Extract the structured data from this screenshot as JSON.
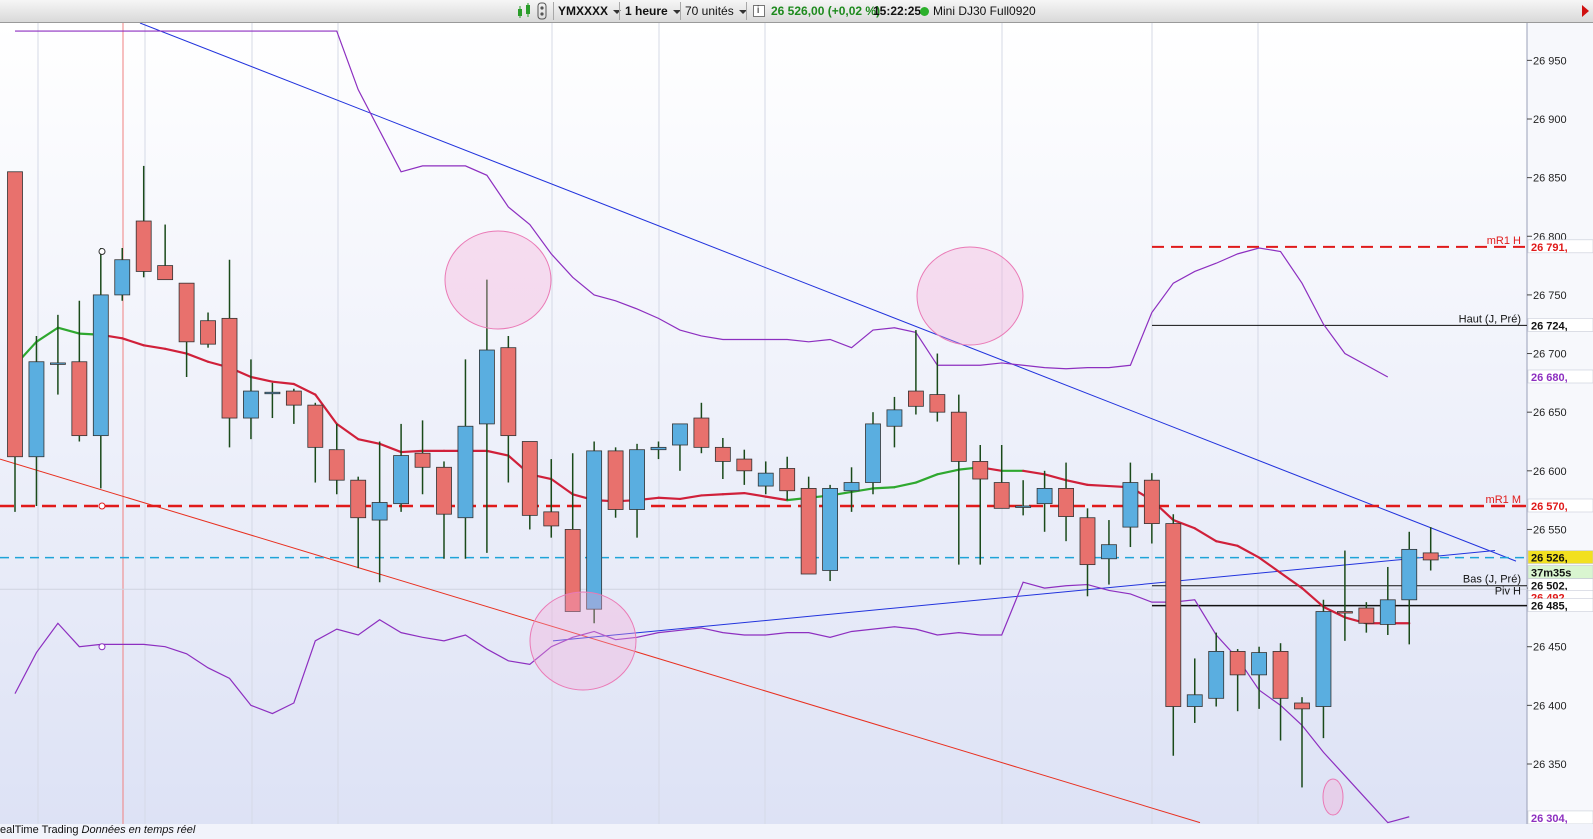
{
  "toolbar": {
    "symbol": "YMXXXX",
    "period": "1 heure",
    "units": "70 unités",
    "info_icon": "i",
    "price_change": "26 526,00 (+0,02 %)",
    "time": "15:22:25",
    "instrument": "Mini DJ30 Full0920"
  },
  "footer": {
    "source": "ealTime Trading",
    "data_label": "Données en temps réel"
  },
  "colors": {
    "up": "#5aaee0",
    "down": "#e8716d",
    "ma": "#d0203a",
    "ma_up": "#2fa82f",
    "bollinger": "#8d2fc0",
    "trend": "#2233dd",
    "support": "#e83020",
    "level": "#e01a1a"
  },
  "chart_data": {
    "type": "candlestick",
    "ylim": [
      26300,
      26980
    ],
    "y_ticks": [
      26350,
      26400,
      26450,
      26500,
      26550,
      26600,
      26650,
      26700,
      26750,
      26800,
      26850,
      26900,
      26950
    ],
    "y_tick_labels": [
      "26 350",
      "26 400",
      "26 450",
      "26 500",
      "26 550",
      "26 600",
      "26 650",
      "26 700",
      "26 750",
      "26 800",
      "26 850",
      "26 900",
      "26 950"
    ],
    "candles": [
      {
        "o": 26855,
        "h": 26855,
        "l": 26565,
        "c": 26612
      },
      {
        "o": 26612,
        "h": 26715,
        "l": 26570,
        "c": 26693
      },
      {
        "o": 26692,
        "h": 26733,
        "l": 26665,
        "c": 26692
      },
      {
        "o": 26693,
        "h": 26745,
        "l": 26625,
        "c": 26630
      },
      {
        "o": 26630,
        "h": 26790,
        "l": 26585,
        "c": 26750
      },
      {
        "o": 26750,
        "h": 26790,
        "l": 26745,
        "c": 26780
      },
      {
        "o": 26813,
        "h": 26860,
        "l": 26765,
        "c": 26770
      },
      {
        "o": 26775,
        "h": 26810,
        "l": 26765,
        "c": 26763
      },
      {
        "o": 26760,
        "h": 26760,
        "l": 26680,
        "c": 26710
      },
      {
        "o": 26728,
        "h": 26735,
        "l": 26705,
        "c": 26708
      },
      {
        "o": 26730,
        "h": 26780,
        "l": 26620,
        "c": 26645
      },
      {
        "o": 26645,
        "h": 26695,
        "l": 26627,
        "c": 26668
      },
      {
        "o": 26666,
        "h": 26675,
        "l": 26645,
        "c": 26667
      },
      {
        "o": 26668,
        "h": 26670,
        "l": 26640,
        "c": 26656
      },
      {
        "o": 26656,
        "h": 26658,
        "l": 26590,
        "c": 26620
      },
      {
        "o": 26618,
        "h": 26640,
        "l": 26580,
        "c": 26592
      },
      {
        "o": 26592,
        "h": 26595,
        "l": 26517,
        "c": 26560
      },
      {
        "o": 26558,
        "h": 26625,
        "l": 26505,
        "c": 26573
      },
      {
        "o": 26572,
        "h": 26640,
        "l": 26565,
        "c": 26613
      },
      {
        "o": 26615,
        "h": 26643,
        "l": 26580,
        "c": 26603
      },
      {
        "o": 26603,
        "h": 26608,
        "l": 26525,
        "c": 26563
      },
      {
        "o": 26560,
        "h": 26695,
        "l": 26525,
        "c": 26638
      },
      {
        "o": 26640,
        "h": 26763,
        "l": 26530,
        "c": 26703
      },
      {
        "o": 26705,
        "h": 26715,
        "l": 26590,
        "c": 26630
      },
      {
        "o": 26625,
        "h": 26625,
        "l": 26550,
        "c": 26562
      },
      {
        "o": 26565,
        "h": 26610,
        "l": 26543,
        "c": 26553
      },
      {
        "o": 26550,
        "h": 26615,
        "l": 26483,
        "c": 26480
      },
      {
        "o": 26482,
        "h": 26625,
        "l": 26470,
        "c": 26617
      },
      {
        "o": 26617,
        "h": 26620,
        "l": 26560,
        "c": 26567
      },
      {
        "o": 26567,
        "h": 26623,
        "l": 26543,
        "c": 26618
      },
      {
        "o": 26618,
        "h": 26625,
        "l": 26610,
        "c": 26620
      },
      {
        "o": 26622,
        "h": 26638,
        "l": 26600,
        "c": 26640
      },
      {
        "o": 26645,
        "h": 26658,
        "l": 26615,
        "c": 26620
      },
      {
        "o": 26620,
        "h": 26628,
        "l": 26593,
        "c": 26608
      },
      {
        "o": 26610,
        "h": 26618,
        "l": 26588,
        "c": 26600
      },
      {
        "o": 26587,
        "h": 26608,
        "l": 26580,
        "c": 26598
      },
      {
        "o": 26602,
        "h": 26612,
        "l": 26575,
        "c": 26583
      },
      {
        "o": 26585,
        "h": 26595,
        "l": 26518,
        "c": 26512
      },
      {
        "o": 26515,
        "h": 26588,
        "l": 26506,
        "c": 26585
      },
      {
        "o": 26583,
        "h": 26603,
        "l": 26565,
        "c": 26590
      },
      {
        "o": 26590,
        "h": 26650,
        "l": 26580,
        "c": 26640
      },
      {
        "o": 26638,
        "h": 26663,
        "l": 26620,
        "c": 26652
      },
      {
        "o": 26668,
        "h": 26720,
        "l": 26648,
        "c": 26655
      },
      {
        "o": 26665,
        "h": 26700,
        "l": 26642,
        "c": 26650
      },
      {
        "o": 26650,
        "h": 26665,
        "l": 26520,
        "c": 26608
      },
      {
        "o": 26608,
        "h": 26622,
        "l": 26520,
        "c": 26593
      },
      {
        "o": 26590,
        "h": 26622,
        "l": 26570,
        "c": 26568
      },
      {
        "o": 26570,
        "h": 26592,
        "l": 26562,
        "c": 26570
      },
      {
        "o": 26572,
        "h": 26600,
        "l": 26548,
        "c": 26585
      },
      {
        "o": 26585,
        "h": 26607,
        "l": 26540,
        "c": 26561
      },
      {
        "o": 26560,
        "h": 26568,
        "l": 26493,
        "c": 26520
      },
      {
        "o": 26525,
        "h": 26558,
        "l": 26503,
        "c": 26537
      },
      {
        "o": 26552,
        "h": 26607,
        "l": 26535,
        "c": 26590
      },
      {
        "o": 26592,
        "h": 26598,
        "l": 26538,
        "c": 26555
      },
      {
        "o": 26555,
        "h": 26563,
        "l": 26357,
        "c": 26399
      },
      {
        "o": 26399,
        "h": 26440,
        "l": 26385,
        "c": 26409
      },
      {
        "o": 26406,
        "h": 26462,
        "l": 26399,
        "c": 26446
      },
      {
        "o": 26446,
        "h": 26448,
        "l": 26395,
        "c": 26426
      },
      {
        "o": 26426,
        "h": 26450,
        "l": 26397,
        "c": 26445
      },
      {
        "o": 26446,
        "h": 26453,
        "l": 26370,
        "c": 26406
      },
      {
        "o": 26402,
        "h": 26407,
        "l": 26330,
        "c": 26397
      },
      {
        "o": 26399,
        "h": 26490,
        "l": 26372,
        "c": 26480
      },
      {
        "o": 26480,
        "h": 26532,
        "l": 26455,
        "c": 26479
      },
      {
        "o": 26483,
        "h": 26488,
        "l": 26462,
        "c": 26470
      },
      {
        "o": 26469,
        "h": 26518,
        "l": 26460,
        "c": 26490
      },
      {
        "o": 26490,
        "h": 26548,
        "l": 26452,
        "c": 26533
      },
      {
        "o": 26530,
        "h": 26552,
        "l": 26515,
        "c": 26524
      }
    ],
    "moving_average": [
      26690,
      26710,
      26722,
      26717,
      26716,
      26713,
      26707,
      26704,
      26700,
      26693,
      26688,
      26680,
      26676,
      26674,
      26665,
      26640,
      26627,
      26623,
      26616,
      26617,
      26617,
      26617,
      26617,
      26613,
      26597,
      26593,
      26580,
      26575,
      26574,
      26575,
      26577,
      26576,
      26579,
      26580,
      26581,
      26578,
      26575,
      26577,
      26579,
      26582,
      26585,
      26586,
      26590,
      26597,
      26601,
      26603,
      26600,
      26600,
      26597,
      26592,
      26588,
      26587,
      26586,
      26575,
      26558,
      26551,
      26540,
      26536,
      26526,
      26513,
      26500,
      26484,
      26475,
      26470,
      26470,
      26470
    ],
    "bollinger_upper": [
      26975,
      26975,
      26975,
      26975,
      26975,
      26975,
      26975,
      26975,
      26975,
      26975,
      26975,
      26975,
      26975,
      26975,
      26975,
      26975,
      26925,
      26890,
      26855,
      26860,
      26860,
      26860,
      26852,
      26825,
      26810,
      26785,
      26765,
      26750,
      26745,
      26738,
      26730,
      26720,
      26715,
      26712,
      26712,
      26712,
      26712,
      26710,
      26712,
      26705,
      26720,
      26722,
      26718,
      26690,
      26690,
      26690,
      26692,
      26690,
      26688,
      26687,
      26688,
      26688,
      26690,
      26735,
      26760,
      26770,
      26777,
      26785,
      26790,
      26787,
      26760,
      26725,
      26700,
      26690,
      26680
    ],
    "bollinger_lower": [
      26410,
      26445,
      26470,
      26450,
      26452,
      26452,
      26452,
      26450,
      26444,
      26432,
      26423,
      26400,
      26393,
      26402,
      26455,
      26465,
      26460,
      26473,
      26462,
      26458,
      26455,
      26460,
      26448,
      26438,
      26435,
      26450,
      26458,
      26463,
      26456,
      26458,
      26462,
      26464,
      26466,
      26462,
      26460,
      26460,
      26462,
      26462,
      26458,
      26463,
      26465,
      26467,
      26465,
      26460,
      26462,
      26460,
      26460,
      26505,
      26500,
      26502,
      26503,
      26498,
      26495,
      26488,
      26488,
      26490,
      26460,
      26440,
      26413,
      26400,
      26383,
      26360,
      26340,
      26320,
      26300,
      26305
    ],
    "levels": [
      {
        "label": "mR1 H",
        "value": 26791,
        "price_tag": "26 791,"
      },
      {
        "label": "Haut (J, Pré)",
        "value": 26724,
        "price_tag": "26 724,"
      },
      {
        "label": "",
        "value": 26680,
        "price_tag": "26 680,"
      },
      {
        "label": "mR1 M",
        "value": 26570,
        "price_tag": "26 570,"
      },
      {
        "label": "",
        "value": 26526,
        "price_tag": "26 526,"
      },
      {
        "label": "",
        "value": 26515,
        "price_tag": "37m35s"
      },
      {
        "label": "Bas (J, Pré)",
        "value": 26502,
        "price_tag": "26 502,"
      },
      {
        "label": "Piv H",
        "value": 26492,
        "price_tag": "26 492,"
      },
      {
        "label": "",
        "value": 26485,
        "price_tag": "26 485,"
      },
      {
        "label": "",
        "value": 26304,
        "price_tag": "26 304,"
      }
    ]
  }
}
